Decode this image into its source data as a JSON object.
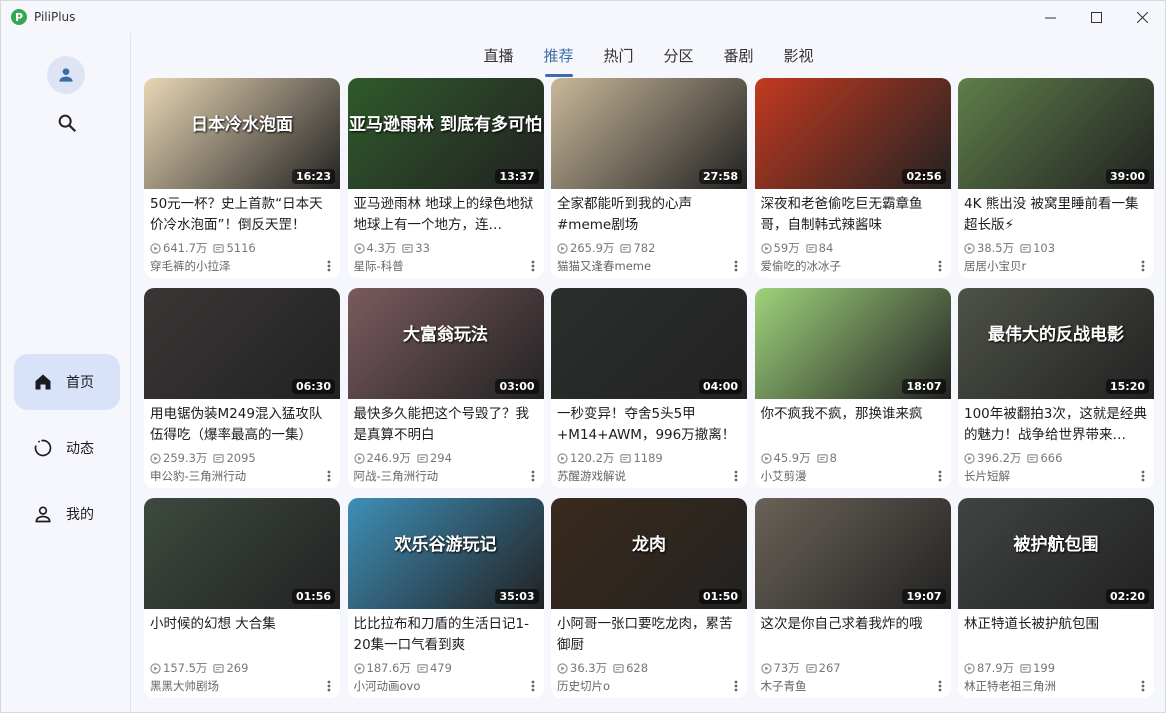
{
  "app": {
    "name": "PiliPlus",
    "logo_letter": "P"
  },
  "tabs": [
    {
      "label": "直播",
      "active": false
    },
    {
      "label": "推荐",
      "active": true
    },
    {
      "label": "热门",
      "active": false
    },
    {
      "label": "分区",
      "active": false
    },
    {
      "label": "番剧",
      "active": false
    },
    {
      "label": "影视",
      "active": false
    }
  ],
  "sidebar": {
    "avatar_icon": "person-icon",
    "search_icon": "search-icon",
    "items": [
      {
        "label": "首页",
        "icon": "home-icon",
        "active": true
      },
      {
        "label": "动态",
        "icon": "refresh-circle-icon",
        "active": false
      },
      {
        "label": "我的",
        "icon": "person-outline-icon",
        "active": false
      }
    ]
  },
  "colors": {
    "accent": "#3b6ea8",
    "active_nav_bg": "#d8e2f8"
  },
  "videos": [
    {
      "title": "50元一杯？史上首款“日本天价冷水泡面”！倒反天罡！",
      "views": "641.7万",
      "danmaku": "5116",
      "uploader": "穿毛裤的小拉泽",
      "duration": "16:23",
      "thumb_text": "日本冷水泡面",
      "thumb_color": "#e9d7b5"
    },
    {
      "title": "亚马逊雨林 地球上的绿色地狱 地球上有一个地方，连…",
      "views": "4.3万",
      "danmaku": "33",
      "uploader": "星际-科普",
      "duration": "13:37",
      "thumb_text": "亚马逊雨林 到底有多可怕",
      "thumb_color": "#2f5a2a"
    },
    {
      "title": "全家都能听到我的心声#meme剧场",
      "views": "265.9万",
      "danmaku": "782",
      "uploader": "猫猫又逢春meme",
      "duration": "27:58",
      "thumb_text": "",
      "thumb_color": "#c9b89a"
    },
    {
      "title": "深夜和老爸偷吃巨无霸章鱼哥，自制韩式辣酱味",
      "views": "59万",
      "danmaku": "84",
      "uploader": "爱偷吃的冰冰子",
      "duration": "02:56",
      "thumb_text": "",
      "thumb_color": "#c23a1f"
    },
    {
      "title": "4K 熊出没 被窝里睡前看一集 超长版⚡",
      "views": "38.5万",
      "danmaku": "103",
      "uploader": "居居小宝贝r",
      "duration": "39:00",
      "thumb_text": "",
      "thumb_color": "#5e7f4a"
    },
    {
      "title": "用电锯伪装M249混入猛攻队伍得吃（爆率最高的一集）",
      "views": "259.3万",
      "danmaku": "2095",
      "uploader": "申公豹-三角洲行动",
      "duration": "06:30",
      "thumb_text": "",
      "thumb_color": "#3a3636"
    },
    {
      "title": "最快多久能把这个号毁了？我是真算不明白",
      "views": "246.9万",
      "danmaku": "294",
      "uploader": "阿战-三角洲行动",
      "duration": "03:00",
      "thumb_text": "大富翁玩法",
      "thumb_color": "#7a5a5e"
    },
    {
      "title": "一秒变异！夺舍5头5甲+M14+AWM，996万撤离！",
      "views": "120.2万",
      "danmaku": "1189",
      "uploader": "苏醒游戏解说",
      "duration": "04:00",
      "thumb_text": "",
      "thumb_color": "#2b2f2c"
    },
    {
      "title": "你不疯我不疯，那换谁来疯",
      "views": "45.9万",
      "danmaku": "8",
      "uploader": "小艾剪漫",
      "duration": "18:07",
      "thumb_text": "",
      "thumb_color": "#9fd37b"
    },
    {
      "title": "100年被翻拍3次，这就是经典的魅力！战争给世界带来…",
      "views": "396.2万",
      "danmaku": "666",
      "uploader": "长片短解",
      "duration": "15:20",
      "thumb_text": "最伟大的反战电影",
      "thumb_color": "#4e5248"
    },
    {
      "title": "小时候的幻想 大合集",
      "views": "157.5万",
      "danmaku": "269",
      "uploader": "黑黑大帅剧场",
      "duration": "01:56",
      "thumb_text": "",
      "thumb_color": "#3d4a3e"
    },
    {
      "title": "比比拉布和刀盾的生活日记1-20集一口气看到爽",
      "views": "187.6万",
      "danmaku": "479",
      "uploader": "小河动画ovo",
      "duration": "35:03",
      "thumb_text": "欢乐谷游玩记",
      "thumb_color": "#3e8fb8"
    },
    {
      "title": "小阿哥一张口要吃龙肉，累苦御厨",
      "views": "36.3万",
      "danmaku": "628",
      "uploader": "历史切片o",
      "duration": "01:50",
      "thumb_text": "龙肉",
      "thumb_color": "#3a2a1c"
    },
    {
      "title": "这次是你自己求着我炸的哦",
      "views": "73万",
      "danmaku": "267",
      "uploader": "木子青鱼",
      "duration": "19:07",
      "thumb_text": "",
      "thumb_color": "#6a6258"
    },
    {
      "title": "林正特道长被护航包围",
      "views": "87.9万",
      "danmaku": "199",
      "uploader": "林正特老祖三角洲",
      "duration": "02:20",
      "thumb_text": "被护航包围",
      "thumb_color": "#3f4442"
    }
  ]
}
